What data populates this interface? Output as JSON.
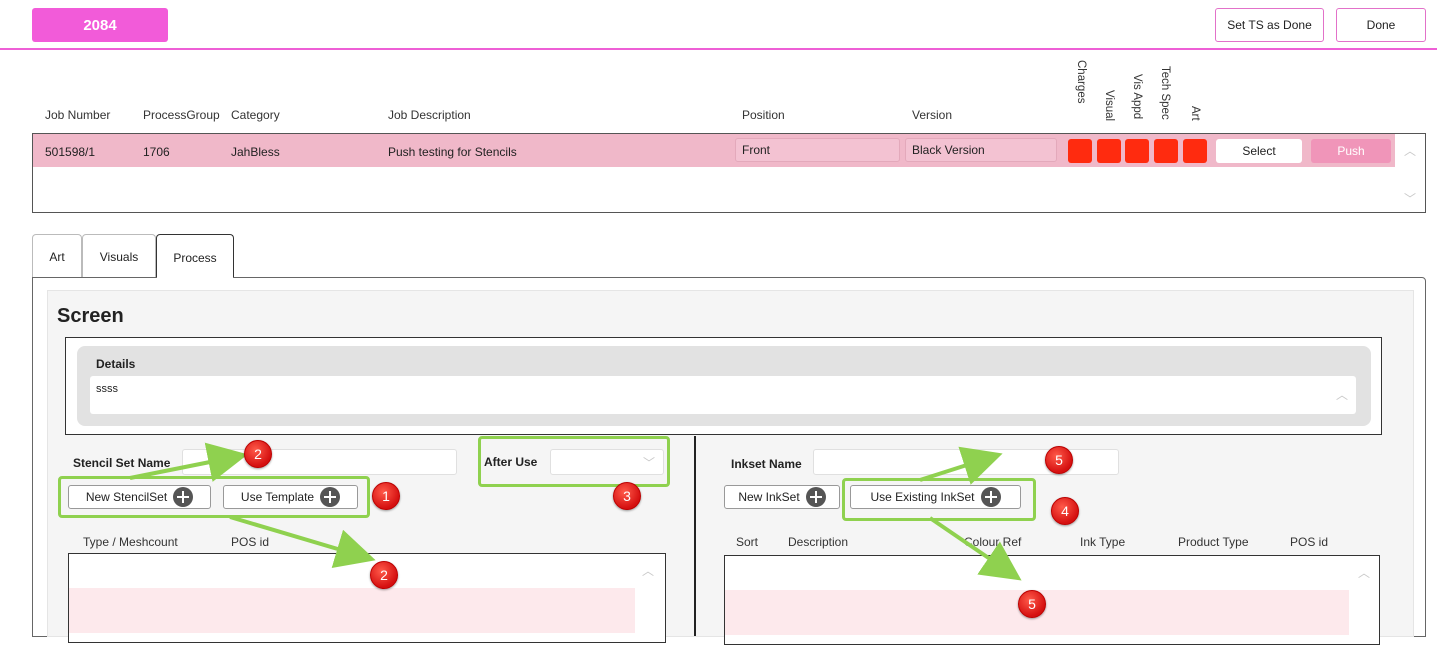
{
  "header": {
    "job_badge": "2084",
    "set_ts_done_label": "Set TS as Done",
    "done_label": "Done"
  },
  "jobs_table": {
    "columns": {
      "job_number": "Job Number",
      "process_group": "ProcessGroup",
      "category": "Category",
      "job_description": "Job Description",
      "position": "Position",
      "version": "Version",
      "charges": "Charges",
      "visual": "Visual",
      "vis_appd": "Vis Appd",
      "tech_spec": "Tech Spec",
      "art": "Art"
    },
    "row": {
      "job_number": "501598/1",
      "process_group": "1706",
      "category": "JahBless",
      "job_description": "Push testing for Stencils",
      "position": "Front",
      "version": "Black Version",
      "select_label": "Select",
      "push_label": "Push"
    }
  },
  "tabs": [
    {
      "label": "Art"
    },
    {
      "label": "Visuals"
    },
    {
      "label": "Process"
    }
  ],
  "screen": {
    "title": "Screen",
    "details_label": "Details",
    "details_text": "ssss",
    "stencil": {
      "name_label": "Stencil Set Name",
      "name_value": "",
      "new_label": "New StencilSet",
      "template_label": "Use Template",
      "after_use_label": "After Use",
      "after_use_value": "",
      "columns": [
        "Type / Meshcount",
        "POS id"
      ]
    },
    "inkset": {
      "name_label": "Inkset Name",
      "name_value": "",
      "new_label": "New InkSet",
      "existing_label": "Use Existing InkSet",
      "columns": [
        "Sort",
        "Description",
        "Colour Ref",
        "Ink Type",
        "Product Type",
        "POS id"
      ]
    }
  },
  "annotations": {
    "m2a": "2",
    "m1": "1",
    "m2b": "2",
    "m3": "3",
    "m5a": "5",
    "m4": "4",
    "m5b": "5"
  },
  "colors": {
    "accent": "#f25bd9",
    "row_bg": "#f0b8c9",
    "status_red": "#ff2b0f",
    "annotation_green": "#8fd14f",
    "marker_red": "#d51010"
  }
}
